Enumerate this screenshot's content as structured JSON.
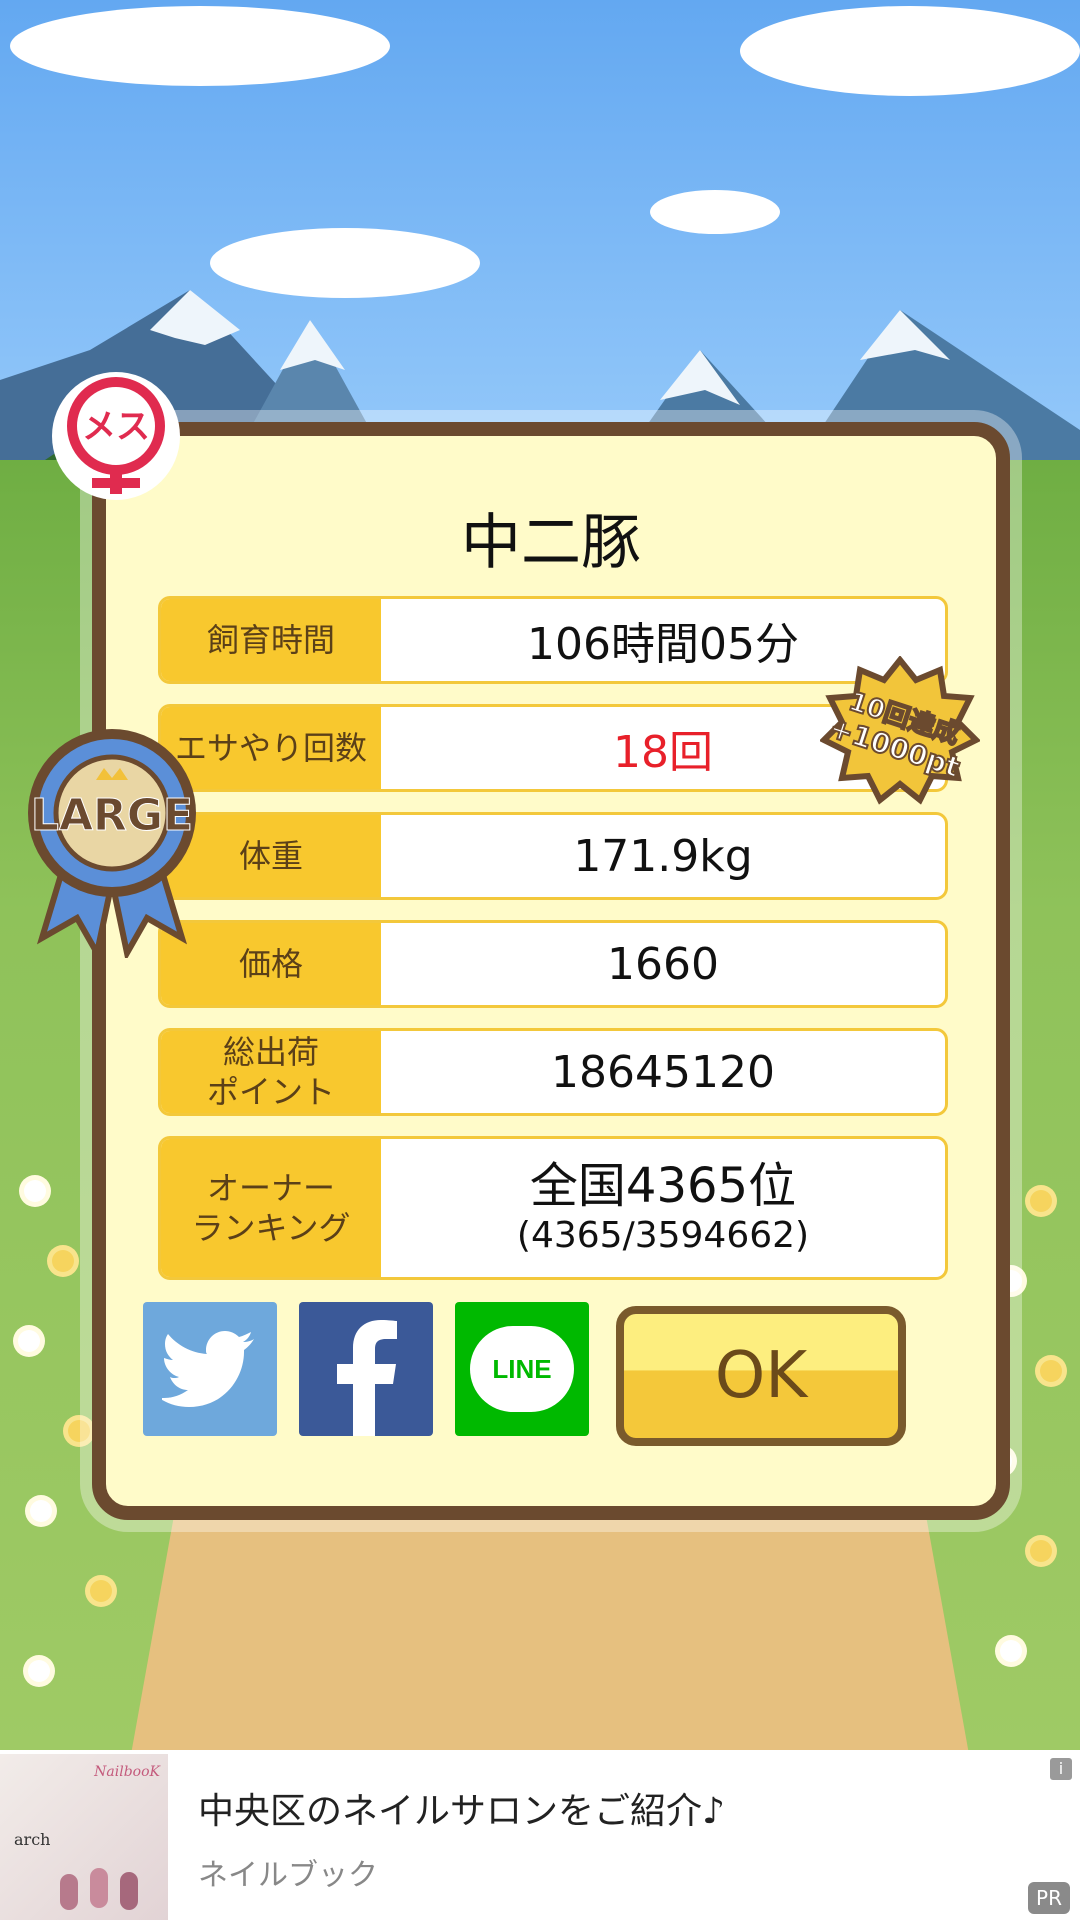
{
  "title": "中二豚",
  "badges": {
    "gender": "メス",
    "size": "LARGE",
    "bonus_line1": "10回達成",
    "bonus_line2": "+1000pt"
  },
  "stats": [
    {
      "label": "飼育時間",
      "value": "106時間05分"
    },
    {
      "label": "エサやり回数",
      "value": "18回"
    },
    {
      "label": "体重",
      "value": "171.9kg"
    },
    {
      "label": "価格",
      "value": "1660"
    },
    {
      "label": "総出荷\nポイント",
      "value": "18645120"
    }
  ],
  "ranking": {
    "label": "オーナー\nランキング",
    "value": "全国4365位",
    "detail": "(4365/3594662)"
  },
  "share": {
    "twitter_icon": "twitter-icon",
    "facebook_icon": "facebook-icon",
    "line_label": "LINE"
  },
  "ok_label": "OK",
  "ad": {
    "title": "中央区のネイルサロンをご紹介♪",
    "subtitle": "ネイルブック",
    "pr": "PR",
    "info": "i",
    "image_text": "arch",
    "image_logo": "NailbooK"
  },
  "colors": {
    "panel_bg": "#fffbc9",
    "panel_border": "#6b4a2f",
    "label_bg": "#f8c82e",
    "highlight_red": "#e8202a",
    "twitter": "#6ea8dc",
    "facebook": "#3b5998",
    "line": "#00b900"
  }
}
